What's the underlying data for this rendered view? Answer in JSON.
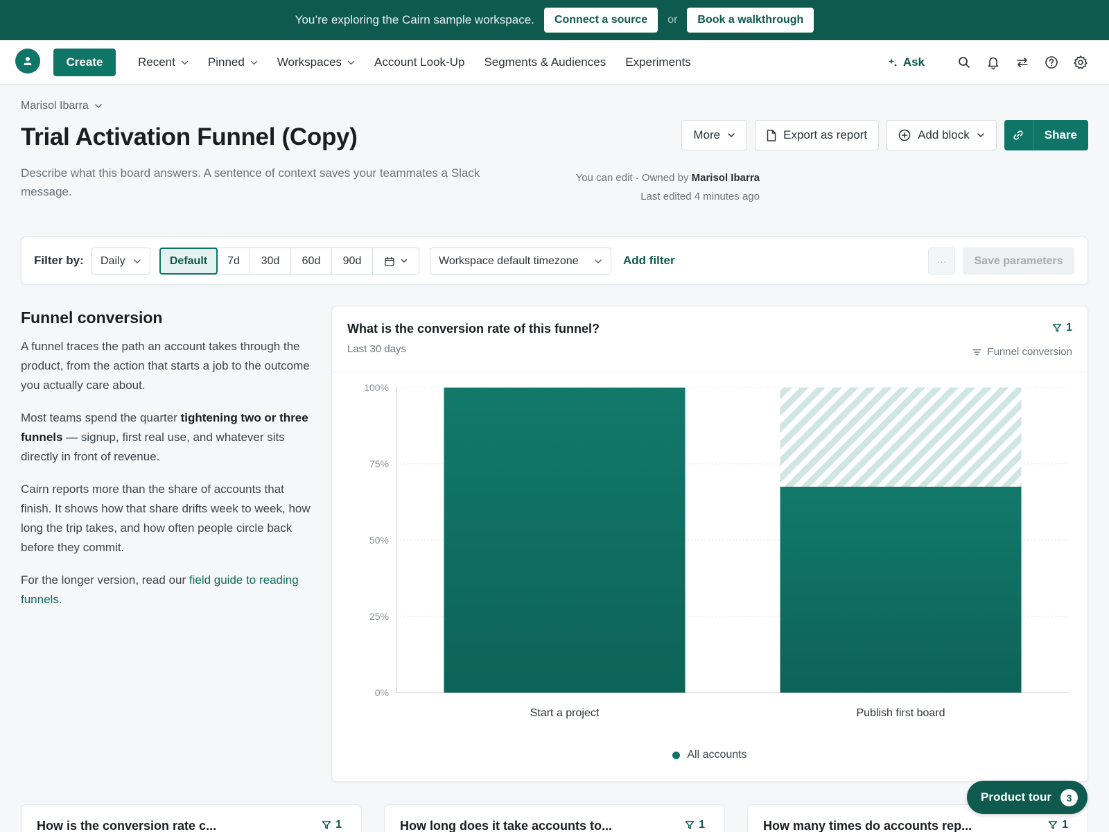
{
  "banner": {
    "text": "You’re exploring the Cairn sample workspace.",
    "connect_label": "Connect a source",
    "or_label": "or",
    "walkthrough_label": "Book a walkthrough"
  },
  "nav": {
    "create_label": "Create",
    "items": [
      {
        "label": "Recent",
        "dropdown": true
      },
      {
        "label": "Pinned",
        "dropdown": true
      },
      {
        "label": "Workspaces",
        "dropdown": true
      },
      {
        "label": "Account Look-Up",
        "dropdown": false
      },
      {
        "label": "Segments & Audiences",
        "dropdown": false
      },
      {
        "label": "Experiments",
        "dropdown": false
      }
    ],
    "ask_label": "Ask",
    "icons": [
      "search-icon",
      "bell-icon",
      "swap-icon",
      "help-icon",
      "gear-icon"
    ]
  },
  "header": {
    "owner_label": "Marisol Ibarra",
    "title": "Trial Activation Funnel (Copy)",
    "description": "Describe what this board answers. A sentence of context saves your teammates a Slack message.",
    "permission_prefix": "You can edit · Owned by",
    "owner_name": "Marisol Ibarra",
    "last_edited": "Last edited 4 minutes ago",
    "more_label": "More",
    "export_label": "Export as report",
    "add_block_label": "Add block",
    "share_label": "Share"
  },
  "filter_bar": {
    "label": "Filter by:",
    "granularity": "Daily",
    "ranges": [
      "Default",
      "7d",
      "30d",
      "60d",
      "90d"
    ],
    "active_range": "Default",
    "timezone": "Workspace default timezone",
    "add_filter_label": "Add filter",
    "more_label": "···",
    "save_label": "Save parameters"
  },
  "sidebar_text": {
    "heading": "Funnel conversion",
    "p1": "A funnel traces the path an account takes through the product, from the action that starts a job to the outcome you actually care about.",
    "p2_before": "Most teams spend the quarter ",
    "p2_bold": "tightening two or three funnels",
    "p2_after": " — signup, first real use, and whatever sits directly in front of revenue.",
    "p3": "Cairn reports more than the share of accounts that finish. It shows how that share drifts week to week, how long the trip takes, and how often people circle back before they commit.",
    "p4_before": "For the longer version, read our ",
    "p4_link": "field guide to reading funnels",
    "p4_after": "."
  },
  "chart_card": {
    "title": "What is the conversion rate of this funnel?",
    "subtitle": "Last 30 days",
    "filter_count": "1",
    "sort_label": "Funnel conversion"
  },
  "chart_data": {
    "type": "bar",
    "categories": [
      "Start a project",
      "Publish first board"
    ],
    "series": [
      {
        "name": "All accounts",
        "values": [
          100,
          67.5
        ],
        "color": "#0f7566"
      }
    ],
    "dropoff_values": [
      0,
      32.5
    ],
    "dropoff_color": "#cfe6e1",
    "ylim": [
      0,
      100
    ],
    "yticks": [
      0,
      25,
      50,
      75,
      100
    ],
    "ytick_labels": [
      "0%",
      "25%",
      "50%",
      "75%",
      "100%"
    ],
    "grid": true,
    "legend_position": "bottom"
  },
  "bottom_cards": [
    {
      "title": "How is the conversion rate c...",
      "filter_count": "1"
    },
    {
      "title": "How long does it take accounts to...",
      "filter_count": "1"
    },
    {
      "title": "How many times do accounts rep...",
      "filter_count": "1"
    }
  ],
  "tour": {
    "label": "Product tour",
    "count": "3"
  }
}
